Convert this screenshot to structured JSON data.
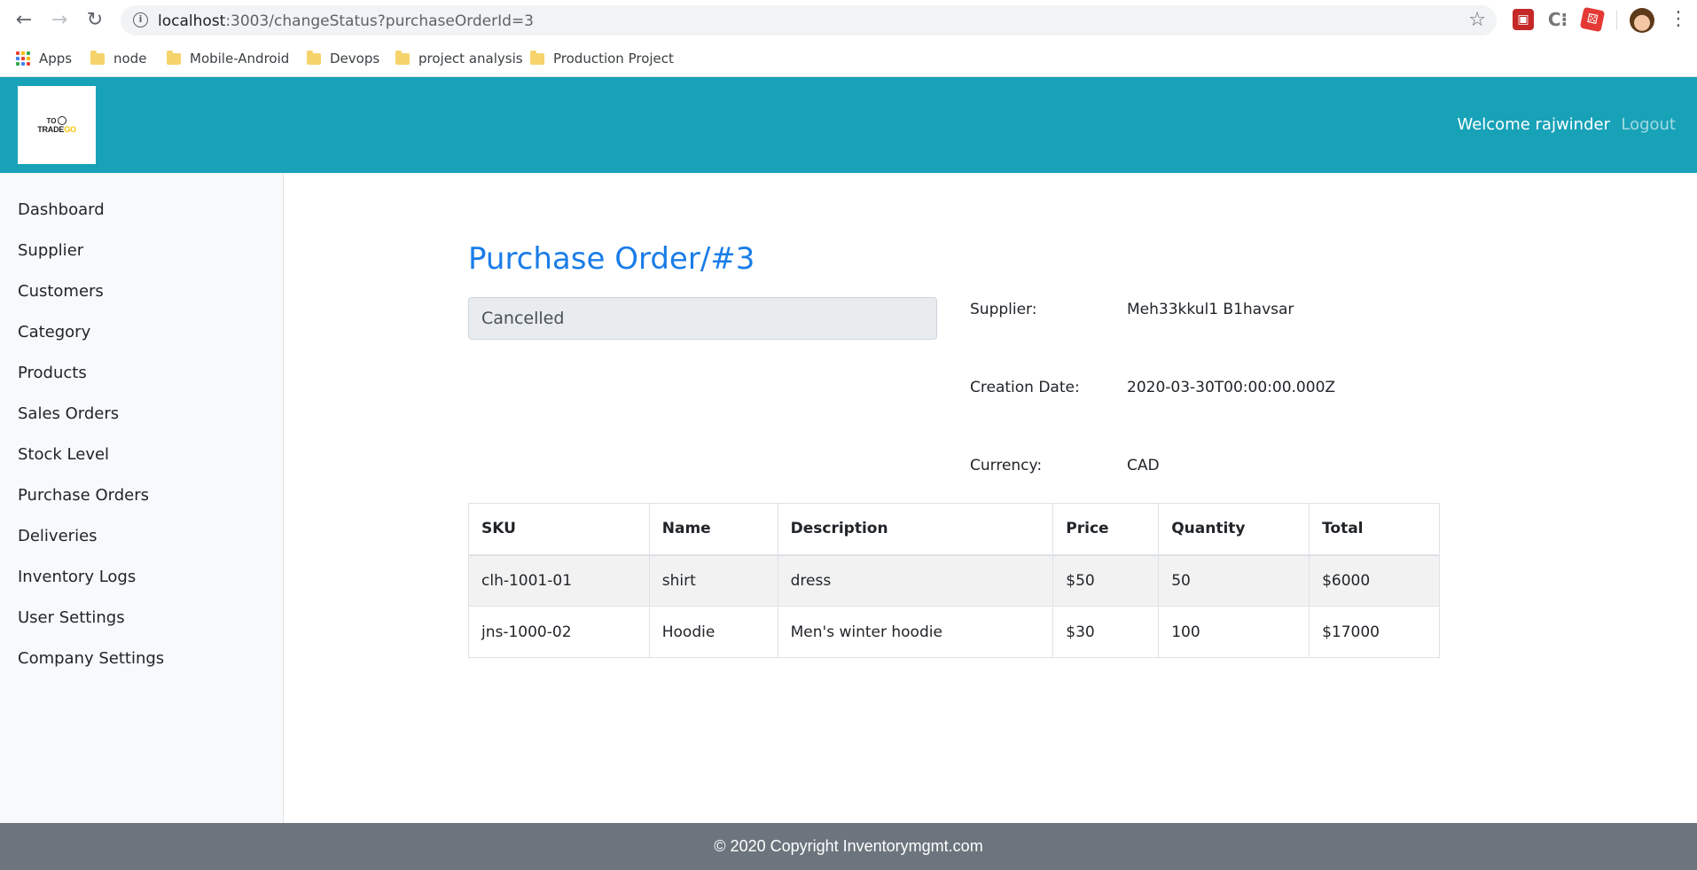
{
  "browser": {
    "url_host": "localhost",
    "url_path": ":3003/changeStatus?purchaseOrderId=3",
    "bookmarks": [
      "Apps",
      "node",
      "Mobile-Android",
      "Devops",
      "project analysis",
      "Production Project"
    ],
    "ext2_label": "C⁝"
  },
  "header": {
    "logo_top": "TO",
    "logo_text_a": "TRADE",
    "logo_text_b": "GO",
    "welcome": "Welcome rajwinder",
    "logout": "Logout"
  },
  "sidebar": {
    "items": [
      "Dashboard",
      "Supplier",
      "Customers",
      "Category",
      "Products",
      "Sales Orders",
      "Stock Level",
      "Purchase Orders",
      "Deliveries",
      "Inventory Logs",
      "User Settings",
      "Company Settings"
    ]
  },
  "main": {
    "title": "Purchase Order/#3",
    "status": "Cancelled",
    "supplier_label": "Supplier:",
    "supplier_value": "Meh33kkul1 B1havsar",
    "date_label": "Creation Date:",
    "date_value": "2020-03-30T00:00:00.000Z",
    "currency_label": "Currency:",
    "currency_value": "CAD"
  },
  "table": {
    "headers": [
      "SKU",
      "Name",
      "Description",
      "Price",
      "Quantity",
      "Total"
    ],
    "rows": [
      [
        "clh-1001-01",
        "shirt",
        "dress",
        "$50",
        "50",
        "$6000"
      ],
      [
        "jns-1000-02",
        "Hoodie",
        "Men's winter hoodie",
        "$30",
        "100",
        "$17000"
      ]
    ]
  },
  "footer": {
    "text": "© 2020 Copyright Inventorymgmt.com"
  },
  "colors": {
    "header_bg": "#17a2b8",
    "title": "#1a7de8",
    "footer_bg": "#6c757d"
  }
}
